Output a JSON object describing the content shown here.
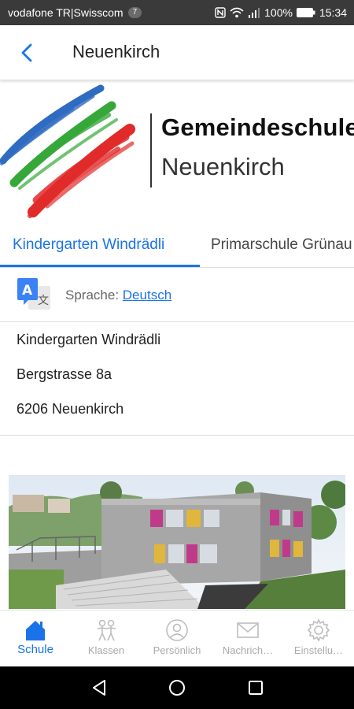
{
  "status_bar": {
    "carrier": "vodafone TR|Swisscom",
    "badge": "7",
    "battery": "100%",
    "time": "15:34"
  },
  "app_bar": {
    "title": "Neuenkirch",
    "back_icon": "back-arrow-icon"
  },
  "logo": {
    "title": "Gemeindeschulen",
    "subtitle": "Neuenkirch",
    "colors": [
      "#2f6bc0",
      "#36a83a",
      "#e12a2a"
    ]
  },
  "tabs": [
    {
      "label": "Kindergarten Windrädli",
      "active": true
    },
    {
      "label": "Primarschule Grünau",
      "active": false
    }
  ],
  "language": {
    "prefix": "Sprache:",
    "value": "Deutsch",
    "icon": "translate-icon"
  },
  "address": {
    "name": "Kindergarten Windrädli",
    "street": "Bergstrasse 8a",
    "city": "6206 Neuenkirch"
  },
  "bottom_nav": [
    {
      "label": "Schule",
      "icon": "home-icon",
      "active": true
    },
    {
      "label": "Klassen",
      "icon": "children-icon",
      "active": false
    },
    {
      "label": "Persönlich",
      "icon": "person-icon",
      "active": false
    },
    {
      "label": "Nachrich…",
      "icon": "mail-icon",
      "active": false
    },
    {
      "label": "Einstellu…",
      "icon": "gear-icon",
      "active": false
    }
  ],
  "colors": {
    "accent": "#1a73e8",
    "status_bar": "#3a3a3a",
    "inactive": "#aaaaaa"
  }
}
